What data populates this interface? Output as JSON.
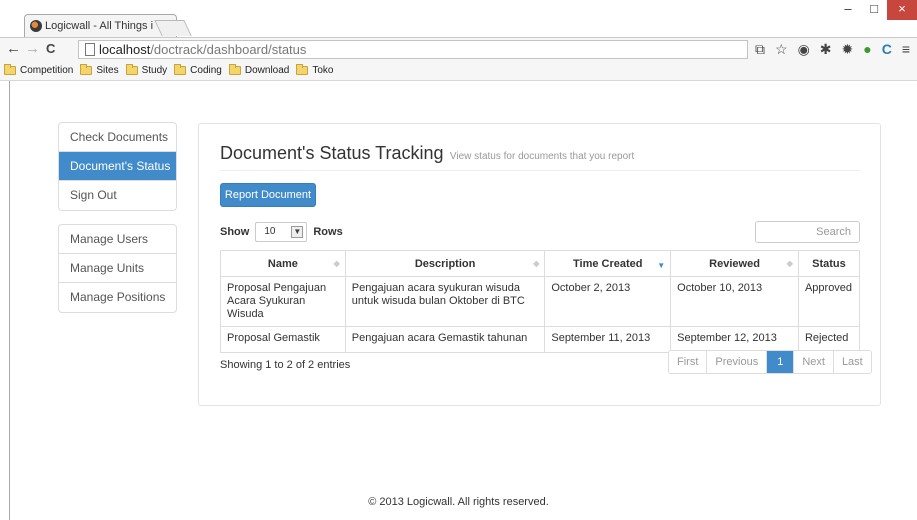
{
  "browser": {
    "tab_title": "Logicwall - All Things is L",
    "tab_close": "×",
    "window_controls": {
      "minimize": "–",
      "maximize": "□",
      "close": "×"
    },
    "url": {
      "host": "localhost",
      "path": "/doctrack/dashboard/status"
    },
    "nav": {
      "back": "←",
      "forward": "→",
      "reload": "C"
    },
    "bookmarks": [
      "Competition",
      "Sites",
      "Study",
      "Coding",
      "Download",
      "Toko"
    ]
  },
  "sidebar": {
    "group1": [
      "Check Documents",
      "Document's Status",
      "Sign Out"
    ],
    "group2": [
      "Manage Users",
      "Manage Units",
      "Manage Positions"
    ]
  },
  "header": {
    "title": "Document's Status Tracking",
    "subtitle": "View status for documents that you report"
  },
  "actions": {
    "report_label": "Report Document"
  },
  "length": {
    "show": "Show",
    "value": "10",
    "rows": "Rows"
  },
  "search": {
    "placeholder": "Search"
  },
  "table": {
    "headers": [
      "Name",
      "Description",
      "Time Created",
      "Reviewed",
      "Status"
    ],
    "rows": [
      {
        "name": "Proposal Pengajuan Acara Syukuran Wisuda",
        "description": "Pengajuan acara syukuran wisuda untuk wisuda bulan Oktober di BTC",
        "created": "October 2, 2013",
        "reviewed": "October 10, 2013",
        "status": "Approved"
      },
      {
        "name": "Proposal Gemastik",
        "description": "Pengajuan acara Gemastik tahunan",
        "created": "September 11, 2013",
        "reviewed": "September 12, 2013",
        "status": "Rejected"
      }
    ]
  },
  "info": "Showing 1 to 2 of 2 entries",
  "pagination": {
    "first": "First",
    "previous": "Previous",
    "current": "1",
    "next": "Next",
    "last": "Last"
  },
  "footer": "© 2013 Logicwall. All rights reserved.",
  "colors": {
    "accent": "#428bca",
    "close_button": "#c7463d",
    "folder": "#f3d56b"
  }
}
